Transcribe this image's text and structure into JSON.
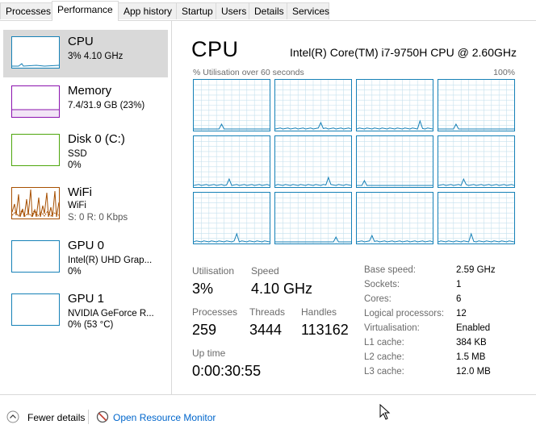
{
  "tabs": [
    "Processes",
    "Performance",
    "App history",
    "Startup",
    "Users",
    "Details",
    "Services"
  ],
  "active_tab": "Performance",
  "sidebar": {
    "items": [
      {
        "name": "CPU",
        "line1": "3%  4.10 GHz",
        "line2": "",
        "color": "#1681b7"
      },
      {
        "name": "Memory",
        "line1": "7.4/31.9 GB (23%)",
        "line2": "",
        "color": "#8b12ae"
      },
      {
        "name": "Disk 0 (C:)",
        "line1": "SSD",
        "line2": "0%",
        "color": "#4da60c"
      },
      {
        "name": "WiFi",
        "line1": "WiFi",
        "line2": "S: 0  R: 0 Kbps",
        "color": "#a74f01"
      },
      {
        "name": "GPU 0",
        "line1": "Intel(R) UHD Grap...",
        "line2": "0%",
        "color": "#1681b7"
      },
      {
        "name": "GPU 1",
        "line1": "NVIDIA GeForce R...",
        "line2": "0%  (53 °C)",
        "color": "#1681b7"
      }
    ]
  },
  "main": {
    "title": "CPU",
    "cpu_model": "Intel(R) Core(TM) i7-9750H CPU @ 2.60GHz",
    "graph_label_left": "% Utilisation over 60 seconds",
    "graph_label_right": "100%",
    "graph_line_color": "#1681b7",
    "graph_grid_color": "#c5e0ee"
  },
  "stats": {
    "utilisation_label": "Utilisation",
    "utilisation_value": "3%",
    "speed_label": "Speed",
    "speed_value": "4.10 GHz",
    "processes_label": "Processes",
    "processes_value": "259",
    "threads_label": "Threads",
    "threads_value": "3444",
    "handles_label": "Handles",
    "handles_value": "113162",
    "uptime_label": "Up time",
    "uptime_value": "0:00:30:55"
  },
  "specs": [
    {
      "key": "Base speed:",
      "value": "2.59 GHz"
    },
    {
      "key": "Sockets:",
      "value": "1"
    },
    {
      "key": "Cores:",
      "value": "6"
    },
    {
      "key": "Logical processors:",
      "value": "12"
    },
    {
      "key": "Virtualisation:",
      "value": "Enabled"
    },
    {
      "key": "L1 cache:",
      "value": "384 KB"
    },
    {
      "key": "L2 cache:",
      "value": "1.5 MB"
    },
    {
      "key": "L3 cache:",
      "value": "12.0 MB"
    }
  ],
  "footer": {
    "fewer_details": "Fewer details",
    "open_resource_monitor": "Open Resource Monitor"
  }
}
